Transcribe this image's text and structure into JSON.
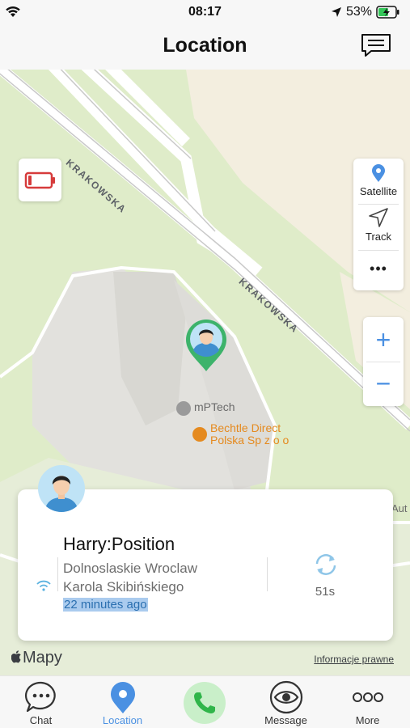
{
  "status_bar": {
    "time": "08:17",
    "battery": "53%"
  },
  "header": {
    "title": "Location"
  },
  "map": {
    "roads": [
      "KRAKOWSKA",
      "KRAKOWSKA"
    ],
    "pois": [
      {
        "label": "mPTech"
      },
      {
        "label_line1": "Bechtle Direct",
        "label_line2": "Polska Sp z o o"
      }
    ],
    "edge_label": "Aut",
    "controls": {
      "satellite": "Satellite",
      "track": "Track",
      "more": "•••"
    },
    "zoom": {
      "in": "+",
      "out": "−"
    },
    "logo": "Mapy",
    "legal": "Informacje prawne"
  },
  "card": {
    "title": "Harry:Position",
    "address_line1": "Dolnoslaskie Wroclaw",
    "address_line2": "Karola Skibińskiego",
    "time_ago": "22 minutes ago",
    "countdown": "51s"
  },
  "tabs": [
    {
      "label": "Chat",
      "icon": "chat-bubble-icon"
    },
    {
      "label": "Location",
      "icon": "location-pin-icon"
    },
    {
      "label": "",
      "icon": "phone-icon"
    },
    {
      "label": "Message",
      "icon": "eye-icon"
    },
    {
      "label": "More",
      "icon": "more-dots-icon"
    }
  ],
  "colors": {
    "accent": "#4a90e2",
    "map_green": "#dfecc9",
    "call_green": "#30b54a",
    "battery_red": "#d63b3b",
    "poi_orange": "#e58a1f"
  }
}
